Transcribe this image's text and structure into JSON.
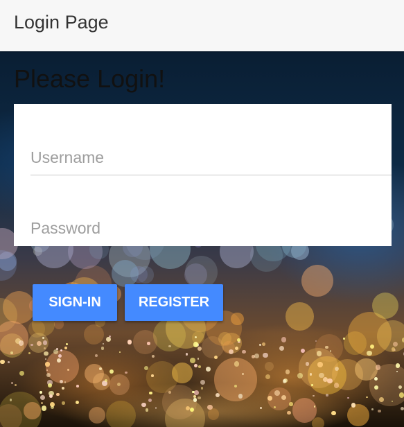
{
  "toolbar": {
    "title": "Login Page"
  },
  "main": {
    "heading": "Please Login!",
    "form": {
      "username_placeholder": "Username",
      "username_value": "",
      "password_placeholder": "Password",
      "password_value": ""
    },
    "buttons": {
      "signin_label": "SIGN-IN",
      "register_label": "REGISTER"
    }
  },
  "colors": {
    "toolbar_bg": "#f7f7f7",
    "button_bg": "#448aff",
    "button_text": "#ffffff",
    "card_bg": "#ffffff"
  }
}
